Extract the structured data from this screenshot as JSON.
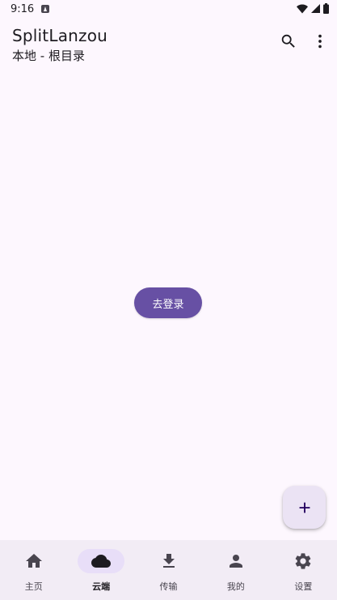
{
  "status_bar": {
    "time": "9:16"
  },
  "app_bar": {
    "title": "SplitLanzou",
    "subtitle": "本地 - 根目录",
    "actions": [
      "search-icon",
      "more-vert-icon"
    ]
  },
  "main": {
    "login_button_label": "去登录"
  },
  "fab": {
    "icon": "add-icon"
  },
  "bottom_nav": {
    "active_index": 1,
    "items": [
      {
        "label": "主页",
        "icon": "home-icon"
      },
      {
        "label": "云端",
        "icon": "cloud-icon"
      },
      {
        "label": "传输",
        "icon": "download-icon"
      },
      {
        "label": "我的",
        "icon": "person-icon"
      },
      {
        "label": "设置",
        "icon": "settings-icon"
      }
    ]
  },
  "colors": {
    "background": "#fdf7fe",
    "primary": "#6750a4",
    "nav_background": "#f2ecf5",
    "nav_indicator": "#e8def8",
    "fab_background": "#ebe3f4",
    "on_surface": "#1d1b20"
  }
}
